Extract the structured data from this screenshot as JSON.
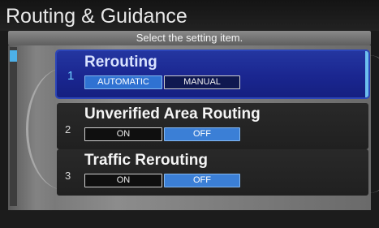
{
  "header": {
    "title": "Routing & Guidance"
  },
  "subheader": {
    "text": "Select the setting item."
  },
  "menu": [
    {
      "number": "1",
      "label": "Rerouting",
      "selected": true,
      "options": [
        "AUTOMATIC",
        "MANUAL"
      ],
      "active_option": "AUTOMATIC"
    },
    {
      "number": "2",
      "label": "Unverified Area Routing",
      "selected": false,
      "options": [
        "ON",
        "OFF"
      ],
      "active_option": "OFF"
    },
    {
      "number": "3",
      "label": "Traffic Rerouting",
      "selected": false,
      "options": [
        "ON",
        "OFF"
      ],
      "active_option": "OFF"
    }
  ],
  "colors": {
    "selected_item_bg": "#1a2690",
    "active_option_bg": "#3b7fd6",
    "accent": "#6dc0f0"
  }
}
